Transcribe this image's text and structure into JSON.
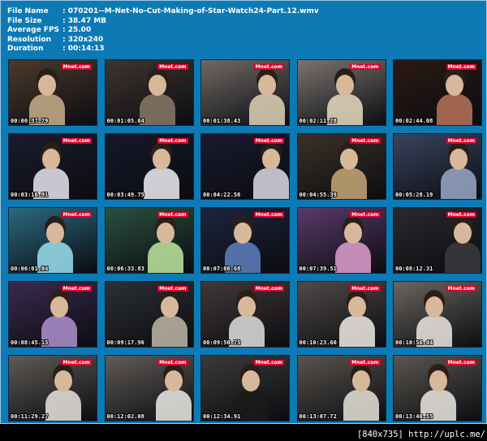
{
  "info": [
    {
      "label": "File Name",
      "value": ": 070201--M-Net-No-Cut-Making-of-Star-Watch24-Part.12.wmv"
    },
    {
      "label": "File Size",
      "value": ": 38.47 MB"
    },
    {
      "label": "Average FPS",
      "value": ": 25.00"
    },
    {
      "label": "Resolution",
      "value": ": 320x240"
    },
    {
      "label": "Duration",
      "value": ": 00:14:13"
    }
  ],
  "logo_text": "Mnet.com",
  "thumbnails": [
    {
      "time": "00:00:37.79",
      "bg": "#4a3a2e",
      "accent": "#c9b08a"
    },
    {
      "time": "00:01:05.64",
      "bg": "#3b3630",
      "accent": "#8a7a68"
    },
    {
      "time": "00:01:38.43",
      "bg": "#6f6a66",
      "accent": "#e0d4b8"
    },
    {
      "time": "00:02:11.28",
      "bg": "#7a7470",
      "accent": "#e8dcc0"
    },
    {
      "time": "00:02:44.08",
      "bg": "#2a1a14",
      "accent": "#b8745a"
    },
    {
      "time": "00:03:16.91",
      "bg": "#1a1c2e",
      "accent": "#e8e8f0"
    },
    {
      "time": "00:03:49.75",
      "bg": "#14182a",
      "accent": "#f0f0f4"
    },
    {
      "time": "00:04:22.56",
      "bg": "#181a30",
      "accent": "#dcdce8"
    },
    {
      "time": "00:04:55.39",
      "bg": "#3a3228",
      "accent": "#c8a878"
    },
    {
      "time": "00:05:28.19",
      "bg": "#3a4460",
      "accent": "#9aa8c8"
    },
    {
      "time": "00:06:01.04",
      "bg": "#2a6a80",
      "accent": "#9ae0f0"
    },
    {
      "time": "00:06:33.83",
      "bg": "#2a5040",
      "accent": "#c0e8a0"
    },
    {
      "time": "00:07:06.68",
      "bg": "#1c2440",
      "accent": "#6080c0"
    },
    {
      "time": "00:07:39.51",
      "bg": "#5a3a6a",
      "accent": "#e0a0d0"
    },
    {
      "time": "00:08:12.31",
      "bg": "#2a2a2e",
      "accent": "#3a3a40"
    },
    {
      "time": "00:08:45.15",
      "bg": "#3a2a50",
      "accent": "#b090d0"
    },
    {
      "time": "00:09:17.96",
      "bg": "#2c3032",
      "accent": "#c0b8a8"
    },
    {
      "time": "00:09:50.75",
      "bg": "#40383a",
      "accent": "#e0e0e0"
    },
    {
      "time": "00:10:23.60",
      "bg": "#504a48",
      "accent": "#f0ece8"
    },
    {
      "time": "00:10:56.44",
      "bg": "#6a6660",
      "accent": "#ece8e0"
    },
    {
      "time": "00:11:29.27",
      "bg": "#5e5a56",
      "accent": "#e8e4e0"
    },
    {
      "time": "00:12:02.08",
      "bg": "#605c58",
      "accent": "#ecece8"
    },
    {
      "time": "00:12:34.91",
      "bg": "#3a3a3a",
      "accent": "#1a1a1a"
    },
    {
      "time": "00:13:07.72",
      "bg": "#58544e",
      "accent": "#e8e4dc"
    },
    {
      "time": "00:13:40.55",
      "bg": "#5a5650",
      "accent": "#ece8e2"
    }
  ],
  "footer": "[840x735] http://uplc.me/"
}
